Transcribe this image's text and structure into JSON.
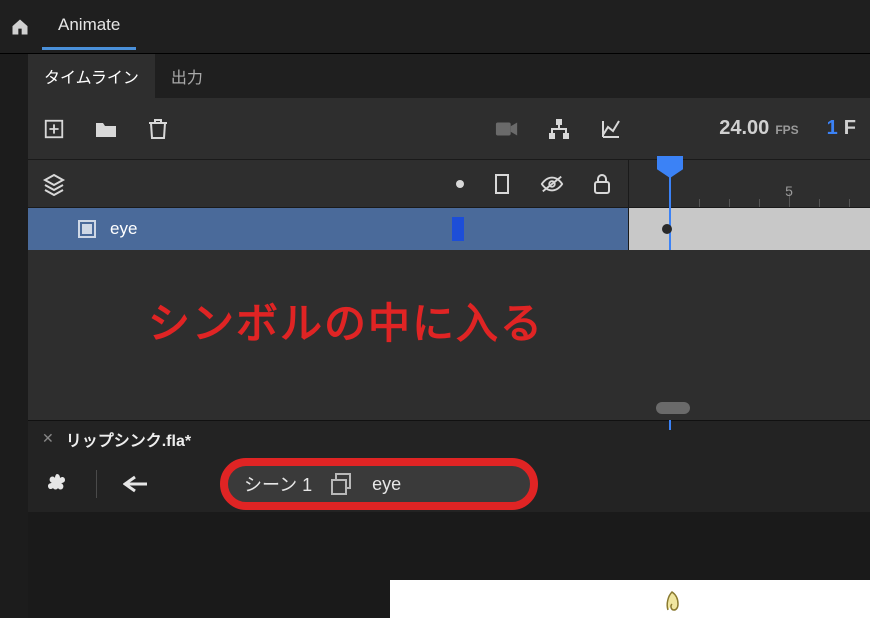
{
  "app": {
    "name": "Animate"
  },
  "panel": {
    "tabs": {
      "timeline": "タイムライン",
      "output": "出力"
    },
    "fps_value": "24.00",
    "fps_unit": "FPS",
    "frame_value": "1",
    "frame_unit": "F"
  },
  "timeline": {
    "ruler_mark": "5",
    "layer": {
      "name": "eye"
    }
  },
  "annotation": {
    "text": "シンボルの中に入る"
  },
  "document": {
    "filename": "リップシンク.fla*"
  },
  "breadcrumb": {
    "scene": "シーン 1",
    "symbol": "eye"
  },
  "icons": {
    "home": "home-icon",
    "add_frame": "add-frame-icon",
    "folder": "folder-icon",
    "trash": "trash-icon",
    "camera": "camera-icon",
    "hierarchy": "hierarchy-icon",
    "graph": "graph-icon",
    "layers": "layers-icon",
    "dot": "highlight-dot-icon",
    "outline": "outline-icon",
    "visibility": "visibility-off-icon",
    "lock": "lock-icon",
    "club": "scene-menu-icon",
    "back": "back-arrow-icon",
    "symbol_box": "symbol-icon"
  }
}
